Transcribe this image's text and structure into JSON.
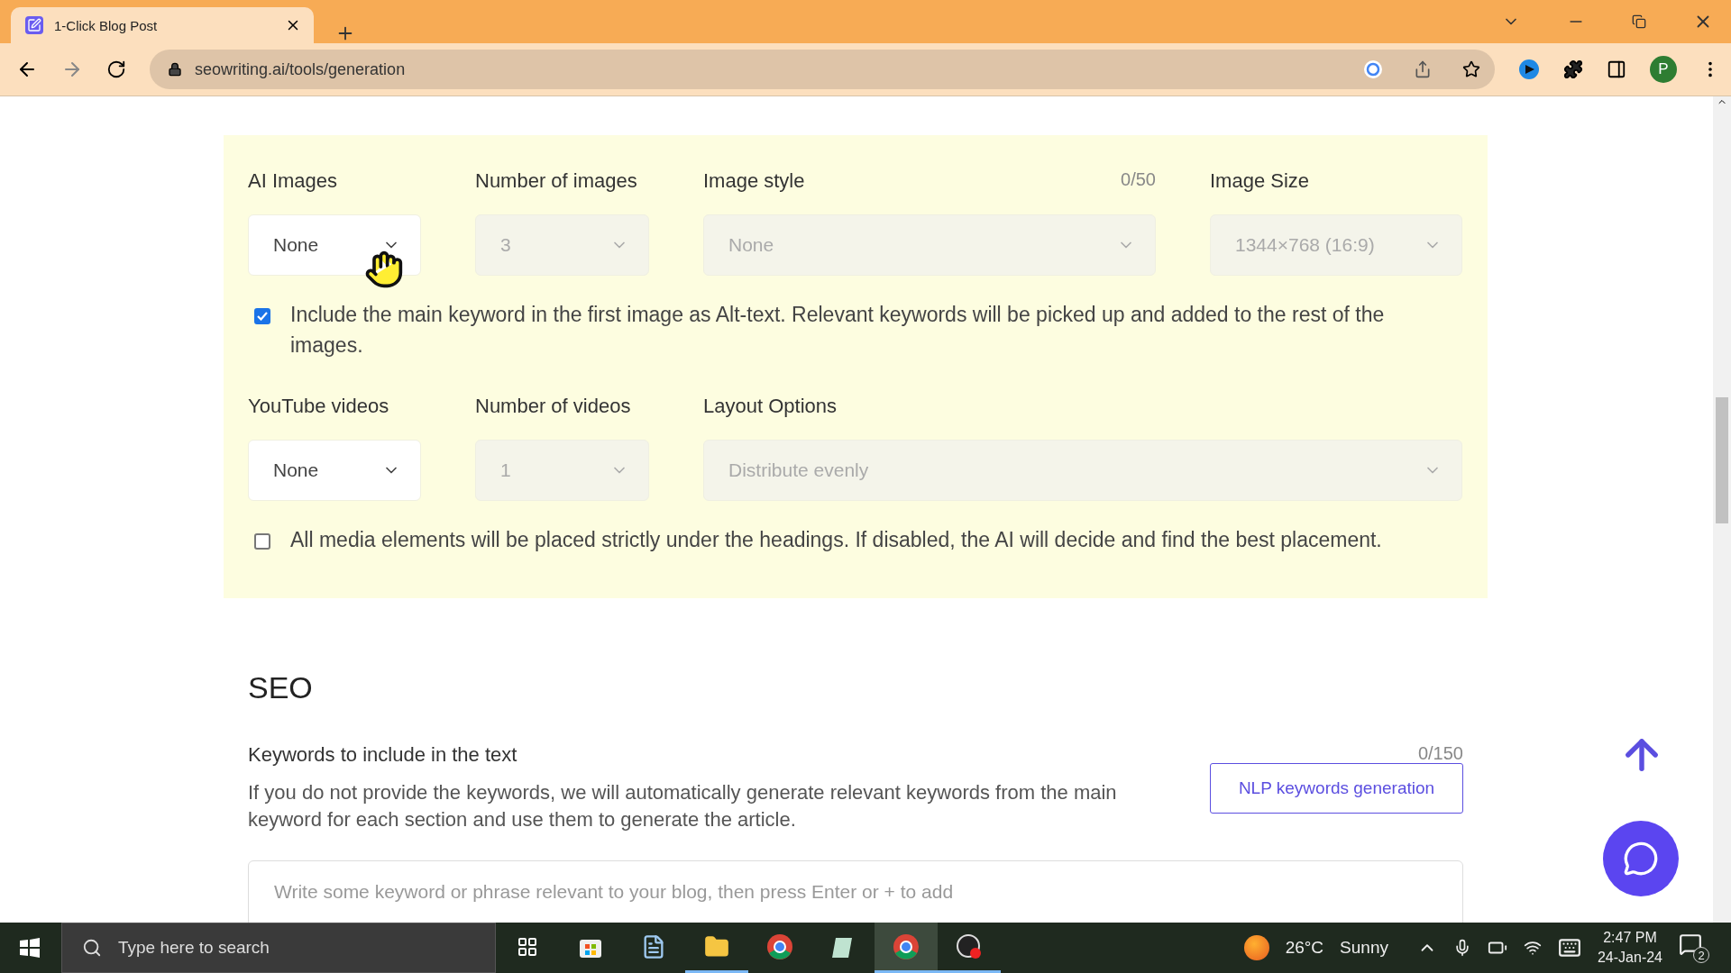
{
  "browser": {
    "tab": {
      "title": "1-Click Blog Post",
      "selected": true
    },
    "url": "seowriting.ai/tools/generation",
    "profile_initial": "P"
  },
  "media": {
    "rows": [
      {
        "fields": [
          {
            "label": "AI Images",
            "value": "None",
            "disabled": false
          },
          {
            "label": "Number of images",
            "value": "3",
            "disabled": true
          },
          {
            "label": "Image style",
            "counter": "0/50",
            "value": "None",
            "disabled": true
          },
          {
            "label": "Image Size",
            "value": "1344×768 (16:9)",
            "disabled": true
          }
        ],
        "option": {
          "text": "Include the main keyword in the first image as Alt-text. Relevant keywords will be picked up and added to the rest of the images.",
          "checked": true
        }
      },
      {
        "fields": [
          {
            "label": "YouTube videos",
            "value": "None",
            "disabled": false
          },
          {
            "label": "Number of videos",
            "value": "1",
            "disabled": true
          },
          {
            "label": "Layout Options",
            "value": "Distribute evenly",
            "disabled": true
          }
        ],
        "option": {
          "text": "All media elements will be placed strictly under the headings. If disabled, the AI will decide and find the best placement.",
          "checked": false
        }
      }
    ]
  },
  "seo": {
    "heading": "SEO",
    "keywords_label": "Keywords to include in the text",
    "counter": "0/150",
    "description": "If you do not provide the keywords, we will automatically generate relevant keywords from the main keyword for each section and use them to generate the article.",
    "button": "NLP keywords generation",
    "placeholder": "Write some keyword or phrase relevant to your blog, then press Enter or + to add"
  },
  "taskbar": {
    "search_placeholder": "Type here to search",
    "apps": [
      {
        "kind": "taskview",
        "running": false,
        "selected": false
      },
      {
        "kind": "store",
        "running": false,
        "selected": false
      },
      {
        "kind": "notepad",
        "running": false,
        "selected": false
      },
      {
        "kind": "folder",
        "running": true,
        "selected": false
      },
      {
        "kind": "chrome",
        "running": false,
        "selected": false
      },
      {
        "kind": "paper",
        "running": false,
        "selected": false
      },
      {
        "kind": "chrome",
        "running": true,
        "selected": true
      },
      {
        "kind": "recorder",
        "running": true,
        "selected": false
      }
    ],
    "temperature": "26°C",
    "weather": "Sunny",
    "time": "2:47 PM",
    "date": "24-Jan-24",
    "notifications": "2"
  }
}
